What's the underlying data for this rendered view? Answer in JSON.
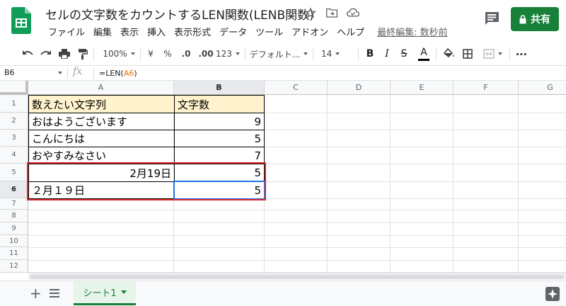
{
  "doc": {
    "title": "セルの文字数をカウントするLEN関数(LENB関数)"
  },
  "menu": {
    "items": [
      "ファイル",
      "編集",
      "表示",
      "挿入",
      "表示形式",
      "データ",
      "ツール",
      "アドオン",
      "ヘルプ"
    ],
    "last_edit": "最終編集: 数秒前"
  },
  "share": {
    "label": "共有"
  },
  "toolbar": {
    "zoom": "100%",
    "currency": "¥",
    "percent": "%",
    "dec_decrease": ".0",
    "dec_increase": ".00",
    "number_format": "123",
    "font": "デフォルト...",
    "font_size": "14",
    "bold": "B",
    "italic": "I",
    "strike": "S",
    "text_color": "A",
    "more": "⋯"
  },
  "formula_bar": {
    "cell_ref": "B6",
    "fx": "fx",
    "formula_prefix": "=LEN(",
    "formula_ref": "A6",
    "formula_suffix": ")"
  },
  "columns": [
    "A",
    "B",
    "C",
    "D",
    "E",
    "F",
    "G"
  ],
  "rows": [
    "1",
    "2",
    "3",
    "4",
    "5",
    "6",
    "7",
    "8",
    "9",
    "10",
    "11",
    "12"
  ],
  "table": {
    "header": [
      "数えたい文字列",
      "文字数"
    ],
    "data": [
      [
        "おはようございます",
        "9"
      ],
      [
        "こんにちは",
        "5"
      ],
      [
        "おやすみなさい",
        "7"
      ],
      [
        "2月19日",
        "5"
      ],
      [
        "２月１９日",
        "5"
      ]
    ]
  },
  "sheet": {
    "tab_label": "シート1"
  },
  "colors": {
    "header_fill": "#fff2cc",
    "share_green": "#188038",
    "highlight_red": "#e0282e",
    "selection_blue": "#1a73e8"
  },
  "icons": [
    "sheets-logo-icon",
    "star-icon",
    "move-folder-icon",
    "cloud-status-icon",
    "comment-icon",
    "lock-icon",
    "undo-icon",
    "redo-icon",
    "print-icon",
    "paint-format-icon",
    "fill-color-icon",
    "borders-icon",
    "merge-icon",
    "add-sheet-icon",
    "all-sheets-icon",
    "explore-icon"
  ]
}
